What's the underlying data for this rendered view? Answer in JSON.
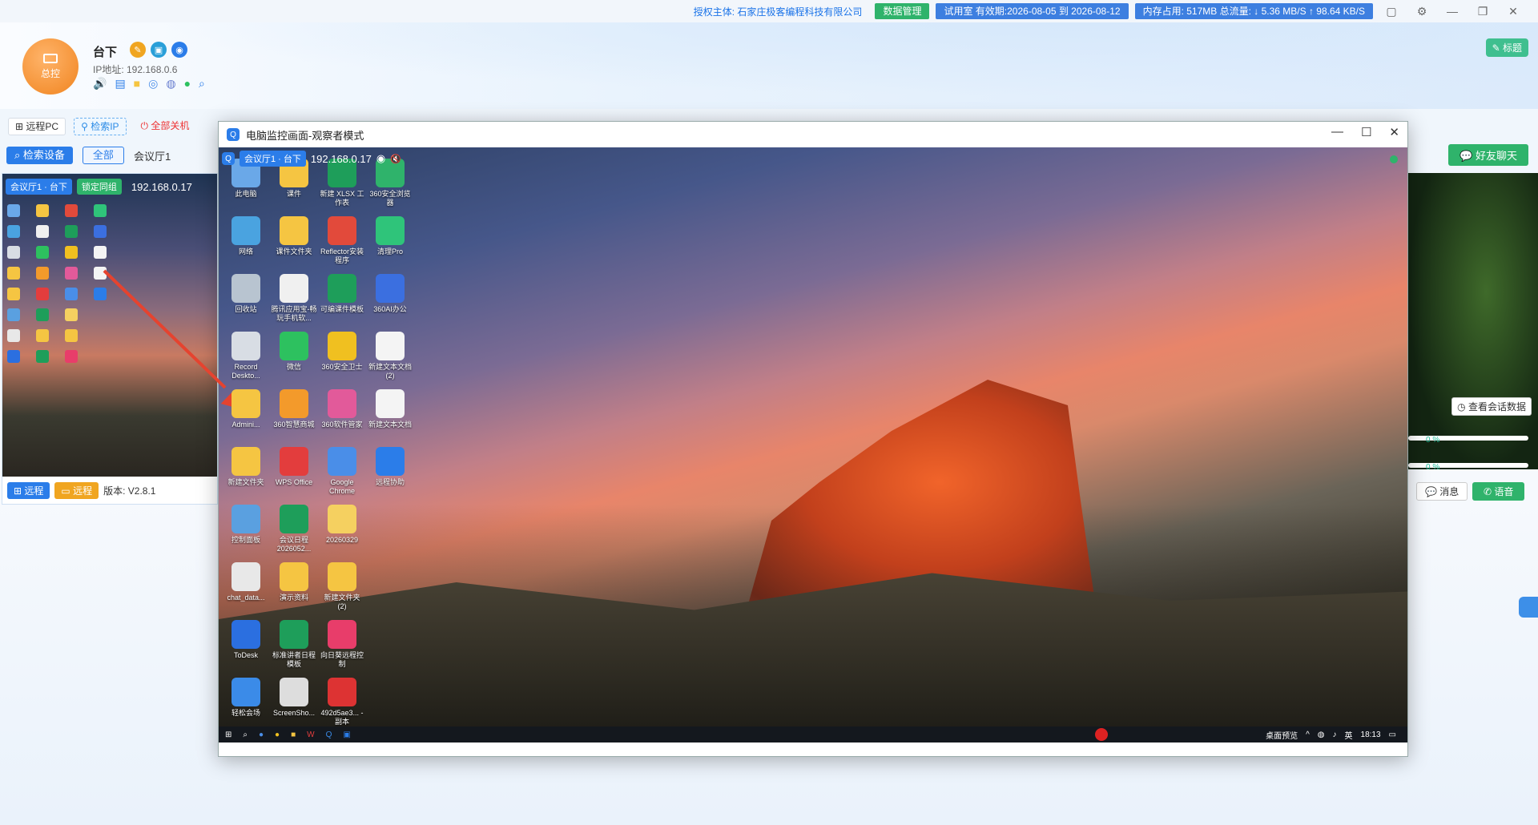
{
  "topbar": {
    "auth": "授权主体: 石家庄极客编程科技有限公司",
    "data_mgmt": "数据管理",
    "trial": "试用室 有效期:2026-08-05 到 2026-08-12",
    "stats": "内存占用: 517MB 总流量: ↓ 5.36 MB/S ↑ 98.64 KB/S"
  },
  "header": {
    "avatar_label": "总控",
    "device_name": "台下",
    "ip": "IP地址: 192.168.0.6",
    "edit_label": "标题"
  },
  "toolbar": {
    "remote_pc": "远程PC",
    "search_ip": "检索IP",
    "shutdown_all": "全部关机"
  },
  "filter": {
    "search_device": "检索设备",
    "all": "全部",
    "room": "会议厅1"
  },
  "card": {
    "room_badge": "会议厅1 · 台下",
    "lock_badge": "锁定同组",
    "ip": "192.168.0.17",
    "remote1": "远程",
    "remote2": "远程",
    "version": "版本: V2.8.1"
  },
  "right_panel": {
    "friend_chat": "好友聊天",
    "session_data": "查看会话数据",
    "pct1": "0 %",
    "pct2": "0 %",
    "message": "消息",
    "voice": "语音"
  },
  "monitor": {
    "title": "电脑监控画面-观察者模式",
    "room_badge": "会议厅1 · 台下",
    "ip": "192.168.0.17"
  },
  "desktop_icons": [
    {
      "label": "此电脑",
      "color": "#6aa8e8"
    },
    {
      "label": "课件",
      "color": "#f5c542"
    },
    {
      "label": "新建 XLSX 工作表",
      "color": "#1e9e5a"
    },
    {
      "label": "360安全浏览器",
      "color": "#2fb36b"
    },
    {
      "label": "网络",
      "color": "#4aa3e0"
    },
    {
      "label": "课件文件夹",
      "color": "#f5c542"
    },
    {
      "label": "Reflector安装程序",
      "color": "#e24a3b"
    },
    {
      "label": "清理Pro",
      "color": "#2fc47a"
    },
    {
      "label": "回收站",
      "color": "#b8c4d0"
    },
    {
      "label": "腾讯应用宝-畅玩手机软...",
      "color": "#f0f0f0"
    },
    {
      "label": "可编课件模板",
      "color": "#1e9e5a"
    },
    {
      "label": "360AI办公",
      "color": "#3b6fe0"
    },
    {
      "label": "Record Deskto...",
      "color": "#d8dde4"
    },
    {
      "label": "微信",
      "color": "#2dc15f"
    },
    {
      "label": "360安全卫士",
      "color": "#f0c020"
    },
    {
      "label": "新建文本文档 (2)",
      "color": "#f4f4f4"
    },
    {
      "label": "Admini...",
      "color": "#f5c542"
    },
    {
      "label": "360智慧商城",
      "color": "#f39a2b"
    },
    {
      "label": "360软件管家",
      "color": "#e25a9a"
    },
    {
      "label": "新建文本文档",
      "color": "#f4f4f4"
    },
    {
      "label": "新建文件夹",
      "color": "#f5c542"
    },
    {
      "label": "WPS Office",
      "color": "#e33d3d"
    },
    {
      "label": "Google Chrome",
      "color": "#4a8ee8"
    },
    {
      "label": "远程协助",
      "color": "#2b7de9"
    },
    {
      "label": "控制面板",
      "color": "#5aa0e0"
    },
    {
      "label": "会议日程 2026052...",
      "color": "#1e9e5a"
    },
    {
      "label": "20260329",
      "color": "#f5d060"
    },
    {
      "label": "",
      "color": "transparent"
    },
    {
      "label": "chat_data...",
      "color": "#e8e8e8"
    },
    {
      "label": "演示资料",
      "color": "#f5c542"
    },
    {
      "label": "新建文件夹 (2)",
      "color": "#f5c542"
    },
    {
      "label": "",
      "color": "transparent"
    },
    {
      "label": "ToDesk",
      "color": "#2b6fe0"
    },
    {
      "label": "标准讲者日程模板",
      "color": "#1e9e5a"
    },
    {
      "label": "向日葵远程控制",
      "color": "#e83d6a"
    },
    {
      "label": "",
      "color": "transparent"
    },
    {
      "label": "轻松会场",
      "color": "#3b8be8"
    },
    {
      "label": "ScreenSho...",
      "color": "#dddddd"
    },
    {
      "label": "492d5ae3... - 副本",
      "color": "#d33"
    }
  ],
  "taskbar": {
    "tray_text": "桌面预览",
    "lang": "英",
    "time": "18:13"
  },
  "colors": {
    "primary": "#2b7de9",
    "green": "#2fb36b",
    "orange": "#f0841f"
  }
}
